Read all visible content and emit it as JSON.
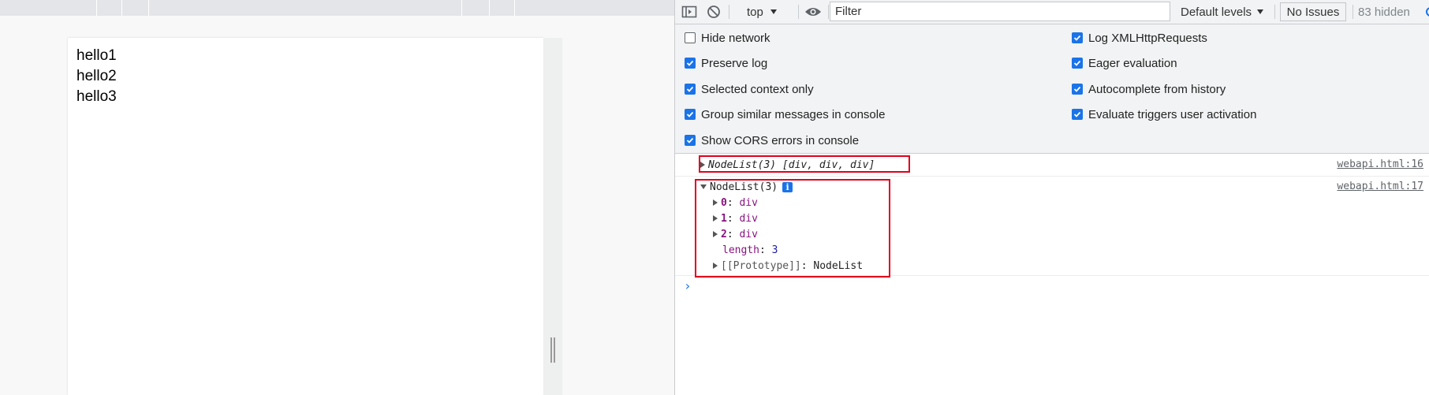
{
  "page": {
    "lines": [
      "hello1",
      "hello2",
      "hello3"
    ]
  },
  "toolbar": {
    "context": "top",
    "filter_placeholder": "Filter",
    "levels_label": "Default levels",
    "issues_label": "No Issues",
    "hidden_label": "83 hidden"
  },
  "settings": {
    "left": [
      {
        "label": "Hide network",
        "checked": false
      },
      {
        "label": "Preserve log",
        "checked": true
      },
      {
        "label": "Selected context only",
        "checked": true
      },
      {
        "label": "Group similar messages in console",
        "checked": true
      },
      {
        "label": "Show CORS errors in console",
        "checked": true
      }
    ],
    "right": [
      {
        "label": "Log XMLHttpRequests",
        "checked": true
      },
      {
        "label": "Eager evaluation",
        "checked": true
      },
      {
        "label": "Autocomplete from history",
        "checked": true
      },
      {
        "label": "Evaluate triggers user activation",
        "checked": true
      }
    ]
  },
  "console": {
    "msg1": {
      "text": "NodeList(3) [div, div, div]",
      "source": "webapi.html:16"
    },
    "msg2": {
      "header": "NodeList(3)",
      "source": "webapi.html:17",
      "items": [
        {
          "key": "0",
          "value": "div"
        },
        {
          "key": "1",
          "value": "div"
        },
        {
          "key": "2",
          "value": "div"
        }
      ],
      "length_key": "length",
      "length_value": "3",
      "proto_key": "[[Prototype]]",
      "proto_value": "NodeList"
    },
    "prompt": "›"
  },
  "colors": {
    "accent": "#1a73e8",
    "highlight_box": "#e0001b"
  }
}
